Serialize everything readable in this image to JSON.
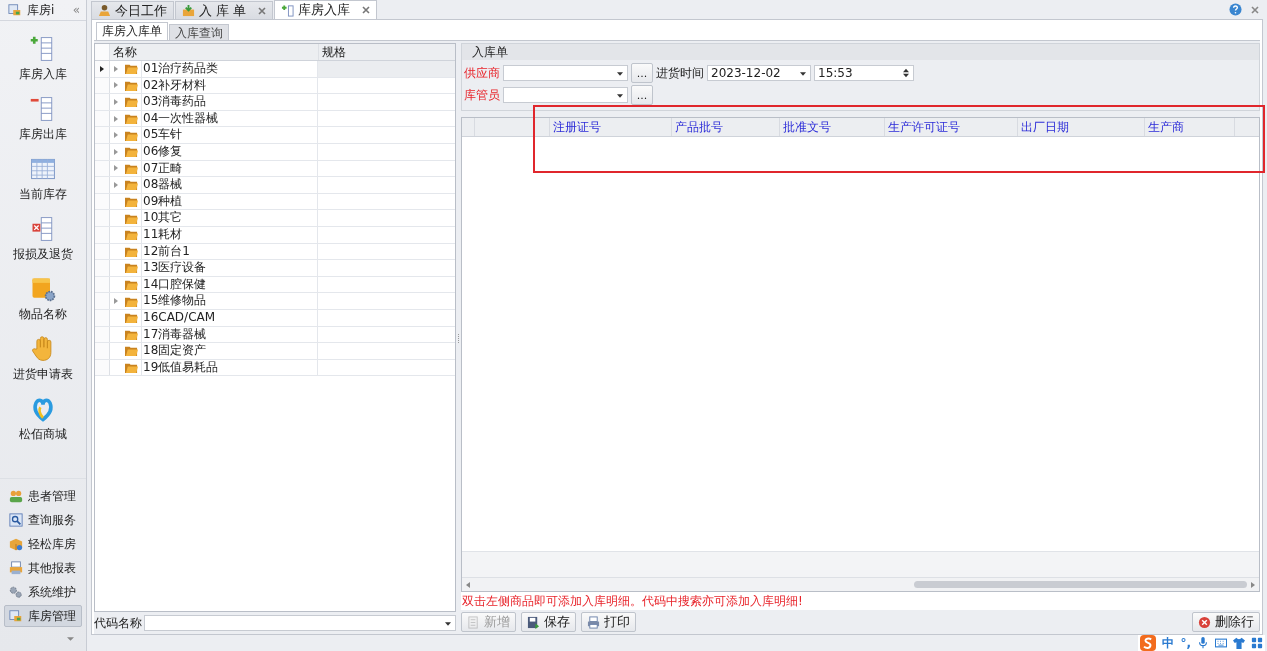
{
  "sidebar": {
    "title": "库房i",
    "collapse": "«",
    "big_items": [
      {
        "label": "库房入库",
        "kind": "add"
      },
      {
        "label": "库房出库",
        "kind": "remove"
      },
      {
        "label": "当前库存",
        "kind": "table"
      },
      {
        "label": "报损及退货",
        "kind": "discard"
      },
      {
        "label": "物品名称",
        "kind": "goods"
      },
      {
        "label": "进货申请表",
        "kind": "hand"
      },
      {
        "label": "松佰商城",
        "kind": "shop"
      }
    ],
    "nav_items": [
      {
        "label": "患者管理",
        "kind": "people",
        "selected": false
      },
      {
        "label": "查询服务",
        "kind": "search",
        "selected": false
      },
      {
        "label": "轻松库房",
        "kind": "box",
        "selected": false
      },
      {
        "label": "其他报表",
        "kind": "printer",
        "selected": false
      },
      {
        "label": "系统维护",
        "kind": "gears",
        "selected": false
      },
      {
        "label": "库房管理",
        "kind": "store",
        "selected": true
      }
    ]
  },
  "tabs": [
    {
      "label": "今日工作",
      "kind": "work",
      "selected": false,
      "closable": false
    },
    {
      "label": "入 库 单",
      "kind": "inbox",
      "selected": false,
      "closable": true
    },
    {
      "label": "库房入库",
      "kind": "add",
      "selected": true,
      "closable": true
    }
  ],
  "subtabs": [
    {
      "label": "库房入库单",
      "selected": true
    },
    {
      "label": "入库查询",
      "selected": false
    }
  ],
  "tree": {
    "columns": [
      "名称",
      "规格"
    ],
    "rows": [
      {
        "name": "01治疗药品类",
        "expandable": true,
        "current": true
      },
      {
        "name": "02补牙材料",
        "expandable": true,
        "current": false
      },
      {
        "name": "03消毒药品",
        "expandable": true,
        "current": false
      },
      {
        "name": "04一次性器械",
        "expandable": true,
        "current": false
      },
      {
        "name": "05车针",
        "expandable": true,
        "current": false
      },
      {
        "name": "06修复",
        "expandable": true,
        "current": false
      },
      {
        "name": "07正畸",
        "expandable": true,
        "current": false
      },
      {
        "name": "08器械",
        "expandable": true,
        "current": false
      },
      {
        "name": "09种植",
        "expandable": false,
        "current": false
      },
      {
        "name": "10其它",
        "expandable": false,
        "current": false
      },
      {
        "name": "11耗材",
        "expandable": false,
        "current": false
      },
      {
        "name": "12前台1",
        "expandable": false,
        "current": false
      },
      {
        "name": "13医疗设备",
        "expandable": false,
        "current": false
      },
      {
        "name": "14口腔保健",
        "expandable": false,
        "current": false
      },
      {
        "name": "15维修物品",
        "expandable": true,
        "current": false
      },
      {
        "name": "16CAD/CAM",
        "expandable": false,
        "current": false
      },
      {
        "name": "17消毒器械",
        "expandable": false,
        "current": false
      },
      {
        "name": "18固定资产",
        "expandable": false,
        "current": false
      },
      {
        "name": "19低值易耗品",
        "expandable": false,
        "current": false
      }
    ]
  },
  "code_field": {
    "label": "代码名称"
  },
  "form": {
    "title": "入库单",
    "supplier_label": "供应商",
    "browse": "...",
    "date_label": "进货时间",
    "date": "2023-12-02",
    "time": "15:53",
    "keeper_label": "库管员",
    "keeper_browse": "..."
  },
  "grid": {
    "columns": [
      "注册证号",
      "产品批号",
      "批准文号",
      "生产许可证号",
      "出厂日期",
      "生产商"
    ]
  },
  "message": "双击左侧商品即可添加入库明细。代码中搜索亦可添加入库明细!",
  "buttons": [
    {
      "label": "新增",
      "kind": "new",
      "disabled": true
    },
    {
      "label": "保存",
      "kind": "save",
      "disabled": false
    },
    {
      "label": "打印",
      "kind": "print",
      "disabled": false
    }
  ],
  "delete_button": "删除行",
  "ime": {
    "mode": "中",
    "punct": "°,"
  }
}
